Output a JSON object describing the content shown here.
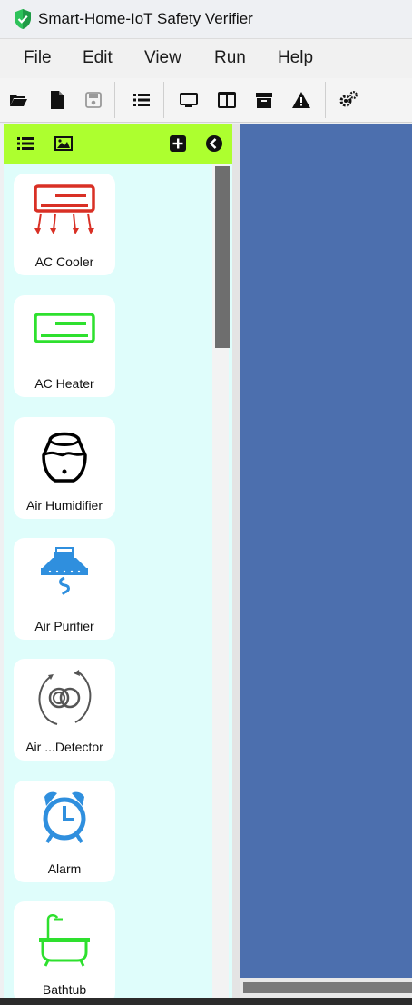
{
  "window": {
    "title": "Smart-Home-IoT Safety Verifier"
  },
  "menu": {
    "items": [
      "File",
      "Edit",
      "View",
      "Run",
      "Help"
    ]
  },
  "toolbar": {
    "buttons": [
      "open-folder-icon",
      "new-file-icon",
      "save-icon",
      "list-icon",
      "monitor-icon",
      "columns-icon",
      "archive-icon",
      "warning-icon",
      "settings-icon"
    ]
  },
  "palette": {
    "header_buttons": [
      "list-view-icon",
      "image-view-icon",
      "add-icon",
      "collapse-icon"
    ],
    "items": [
      {
        "label": "AC Cooler",
        "icon": "ac-cooler-icon",
        "color": "#d93025"
      },
      {
        "label": "AC Heater",
        "icon": "ac-heater-icon",
        "color": "#2ee02e"
      },
      {
        "label": "Air Humidifier",
        "icon": "air-humidifier-icon",
        "color": "#000000"
      },
      {
        "label": "Air Purifier",
        "icon": "air-purifier-icon",
        "color": "#2f8fde"
      },
      {
        "label": "Air ...Detector",
        "icon": "air-detector-icon",
        "color": "#555555"
      },
      {
        "label": "Alarm",
        "icon": "alarm-icon",
        "color": "#2f8fde"
      },
      {
        "label": "Bathtub",
        "icon": "bathtub-icon",
        "color": "#2ee02e"
      }
    ]
  },
  "colors": {
    "palette_header": "#adff2f",
    "palette_background": "#dffdfb",
    "canvas": "#4c6fae"
  }
}
